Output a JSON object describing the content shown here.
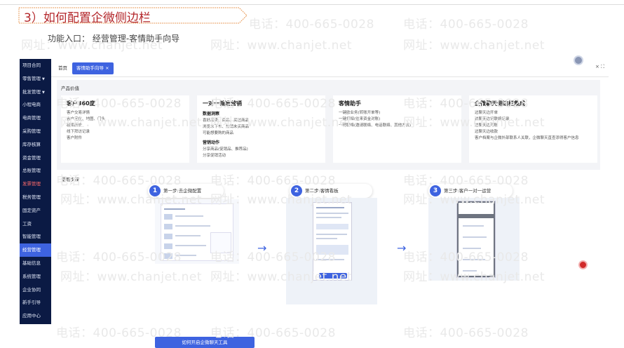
{
  "doc": {
    "heading": "3）如何配置企微侧边栏",
    "entry_label": "功能入口：",
    "entry_path": "经营管理-客情助手向导"
  },
  "watermark": {
    "phone": "电话：400-665-0028",
    "site": "网址：www.chanjet.net"
  },
  "sidebar": {
    "items": [
      {
        "label": "项目合同",
        "arrow": ""
      },
      {
        "label": "零售管理",
        "arrow": "▼"
      },
      {
        "label": "批发管理",
        "arrow": "▼"
      },
      {
        "label": "小程电商",
        "arrow": ""
      },
      {
        "label": "电商管理",
        "arrow": ""
      },
      {
        "label": "采购管理",
        "arrow": ""
      },
      {
        "label": "库存核算",
        "arrow": ""
      },
      {
        "label": "资金管理",
        "arrow": ""
      },
      {
        "label": "总账管理",
        "arrow": ""
      },
      {
        "label": "发票管理",
        "arrow": ""
      },
      {
        "label": "税务管理",
        "arrow": ""
      },
      {
        "label": "固定资产",
        "arrow": ""
      },
      {
        "label": "工资",
        "arrow": ""
      },
      {
        "label": "智能管理",
        "arrow": ""
      },
      {
        "label": "经营管理",
        "arrow": ""
      },
      {
        "label": "基础信息",
        "arrow": ""
      },
      {
        "label": "系统管理",
        "arrow": ""
      },
      {
        "label": "企业协同",
        "arrow": ""
      },
      {
        "label": "新手引导",
        "arrow": ""
      },
      {
        "label": "应用中心",
        "arrow": ""
      }
    ]
  },
  "tabs": {
    "home": "首页",
    "active": "客情助手向导 ×",
    "controls": "× ⛶"
  },
  "value_section": {
    "title": "产品价值",
    "cards": [
      {
        "title": "客户360度",
        "sub1": "",
        "lines1": [
          "客户交易详情",
          "客户定位、地图、门头",
          "联络历史",
          "线下拜访记录",
          "客户附件"
        ],
        "sub2": "",
        "lines2": []
      },
      {
        "title": "一对一精准营销",
        "sub1": "数据洞察",
        "lines1": [
          "喜好品类、商品、买过商品",
          "浏览未下单、热销未买商品",
          "可能想要购的商品"
        ],
        "sub2": "营销动作",
        "lines2": [
          "分享商品(促销品、推荐品)",
          "分享促销活动"
        ]
      },
      {
        "title": "客情助手",
        "sub1": "",
        "lines1": [
          "一键欧业务(转账开单等)",
          "一键打探(往来资金对账)",
          "一键联络(邀请联络、电话联络、其他方式)"
        ],
        "sub2": "",
        "lines2": []
      },
      {
        "title": "企微聊天侧边栏集成",
        "sub1": "",
        "lines1": [
          "边聊天边开单",
          "边聊天边记联络记录",
          "边聊天边对账",
          "边聊天边收款",
          "客户档案与企微外部联系人关联，企微聊天直查添得客户信息"
        ],
        "sub2": "",
        "lines2": []
      }
    ]
  },
  "steps_section": {
    "title": "使用步骤",
    "steps": [
      {
        "num": "1",
        "label": "第一步:去企微配置"
      },
      {
        "num": "2",
        "label": "第二步:客情看板"
      },
      {
        "num": "3",
        "label": "第三步:客户一对一运营"
      }
    ],
    "arrow": "→",
    "cta": "如何开启企微聊天工具"
  }
}
